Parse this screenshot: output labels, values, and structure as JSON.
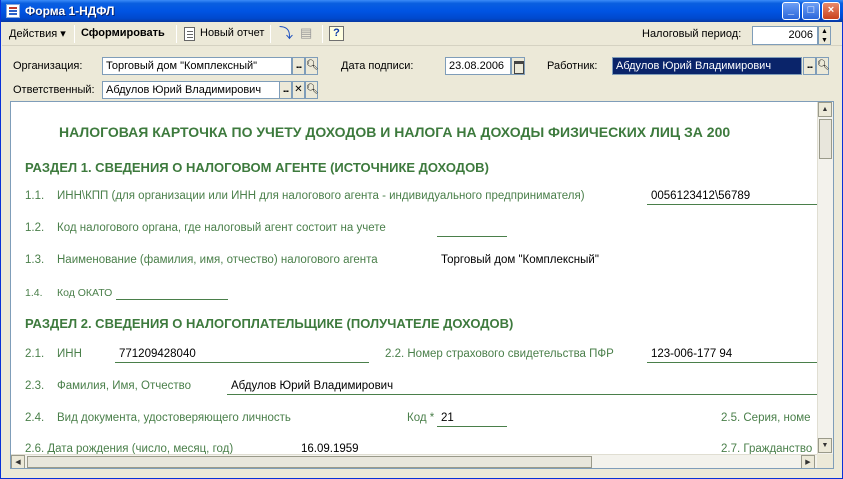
{
  "window": {
    "title": "Форма 1-НДФЛ"
  },
  "toolbar": {
    "actions_label": "Действия",
    "generate_label": "Сформировать",
    "new_report_label": "Новый отчет",
    "period_label": "Налоговый период:",
    "period_value": "2006"
  },
  "form": {
    "org_label": "Организация:",
    "org_value": "Торговый дом \"Комплексный\"",
    "date_label": "Дата подписи:",
    "date_value": "23.08.2006",
    "employee_label": "Работник:",
    "employee_value": "Абдулов Юрий Владимирович",
    "responsible_label": "Ответственный:",
    "responsible_value": "Абдулов Юрий Владимирович"
  },
  "report": {
    "title": "НАЛОГОВАЯ КАРТОЧКА ПО УЧЕТУ ДОХОДОВ И НАЛОГА НА ДОХОДЫ ФИЗИЧЕСКИХ ЛИЦ ЗА 200",
    "section1": "РАЗДЕЛ 1. СВЕДЕНИЯ О НАЛОГОВОМ АГЕНТЕ (ИСТОЧНИКЕ ДОХОДОВ)",
    "r11_num": "1.1.",
    "r11_text": "ИНН\\КПП (для организации или ИНН для налогового агента -  индивидуального предпринимателя)",
    "r11_value": "0056123412\\56789",
    "r12_num": "1.2.",
    "r12_text": "Код налогового органа, где налоговый агент состоит на учете",
    "r13_num": "1.3.",
    "r13_text": "Наименование (фамилия, имя, отчество) налогового агента",
    "r13_value": "Торговый дом \"Комплексный\"",
    "r14_num": "1.4.",
    "r14_text": "Код ОКАТО",
    "section2": "РАЗДЕЛ 2. СВЕДЕНИЯ О НАЛОГОПЛАТЕЛЬЩИКЕ (ПОЛУЧАТЕЛЕ ДОХОДОВ)",
    "r21_num": "2.1.",
    "r21_text": "ИНН",
    "r21_value": "771209428040",
    "r22_text": "2.2. Номер страхового свидетельства ПФР",
    "r22_value": "123-006-177 94",
    "r23_num": "2.3.",
    "r23_text": "Фамилия, Имя, Отчество",
    "r23_value": "Абдулов Юрий Владимирович",
    "r24_num": "2.4.",
    "r24_text": "Вид документа, удостоверяющего личность",
    "r24_code_label": "Код *",
    "r24_code_value": "21",
    "r25_text": "2.5. Серия, номе",
    "r26_text": "2.6. Дата рождения (число, месяц, год)",
    "r26_value": "16.09.1959",
    "r27_text": "2.7. Гражданство"
  }
}
